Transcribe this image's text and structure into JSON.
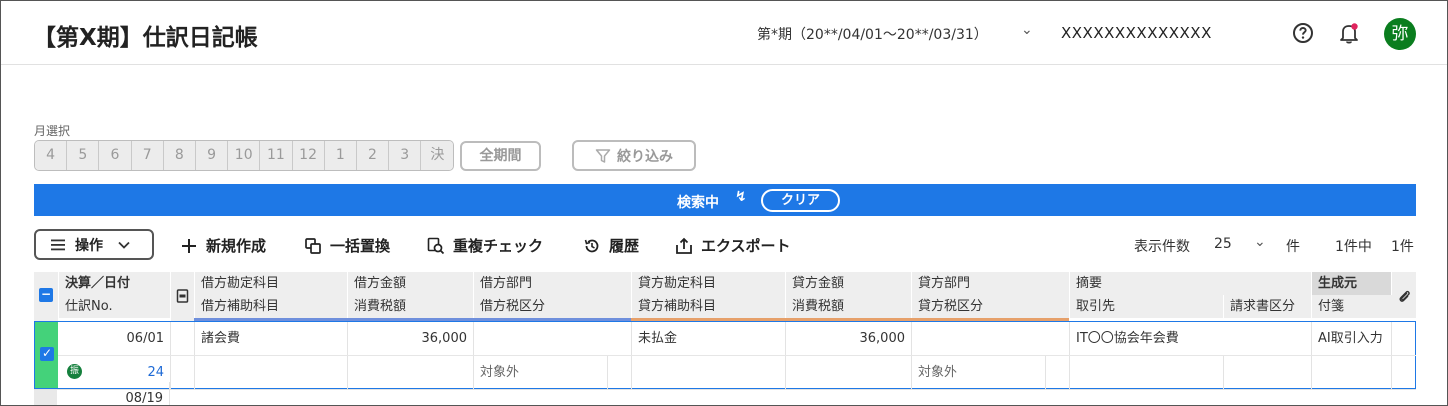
{
  "header": {
    "title": "【第X期】仕訳日記帳",
    "period": "第*期（20**/04/01〜20**/03/31）",
    "company": "XXXXXXXXXXXXXX",
    "avatar": "弥"
  },
  "month_select": {
    "label": "月選択",
    "months": [
      "4",
      "5",
      "6",
      "7",
      "8",
      "9",
      "10",
      "11",
      "12",
      "1",
      "2",
      "3",
      "決"
    ],
    "all_period": "全期間",
    "filter": "絞り込み"
  },
  "search": {
    "label": "検索中",
    "clear": "クリア",
    "color": "#1e78e6"
  },
  "toolbar": {
    "operations": "操作",
    "new": "新規作成",
    "bulk_replace": "一括置換",
    "duplicate_check": "重複チェック",
    "history": "履歴",
    "export": "エクスポート",
    "per_page_label": "表示件数",
    "per_page_value": "25",
    "per_page_unit": "件",
    "result_count": "1件中",
    "total_count": "1件"
  },
  "table": {
    "headers_top": [
      "決算／日付",
      "借方勘定科目",
      "借方金額",
      "借方部門",
      "貸方勘定科目",
      "貸方金額",
      "貸方部門",
      "摘要",
      "生成元"
    ],
    "headers_bottom": [
      "仕訳No.",
      "借方補助科目",
      "消費税額",
      "借方税区分",
      "貸方補助科目",
      "消費税額",
      "貸方税区分",
      "取引先",
      "請求書区分",
      "付箋"
    ],
    "rows": [
      {
        "date": "06/01",
        "no": "24",
        "badge": "振",
        "debit_account": "諸会費",
        "debit_amount": "36,000",
        "debit_tax": "対象外",
        "credit_account": "未払金",
        "credit_amount": "36,000",
        "credit_tax": "対象外",
        "memo": "IT〇〇協会年会費",
        "source": "AI取引入力"
      }
    ],
    "next_date": "08/19"
  }
}
